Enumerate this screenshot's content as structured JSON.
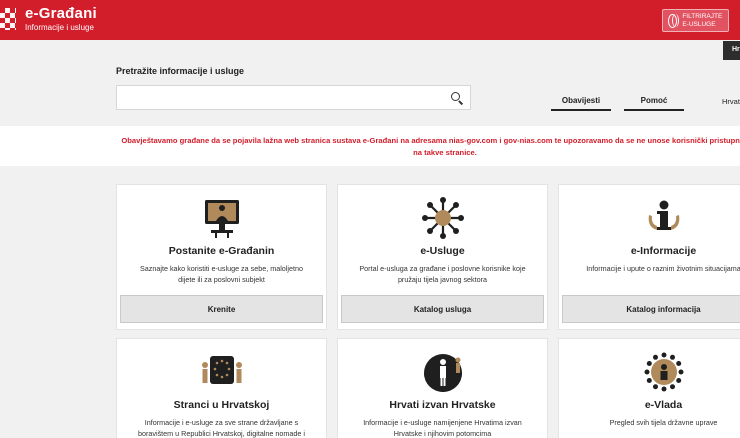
{
  "header": {
    "title": "e-Građani",
    "subtitle": "Informacije i usluge",
    "filter_button": "FILTRIRAJTE E-USLUGE",
    "right_button": "Hr"
  },
  "search": {
    "label": "Pretražite informacije i usluge",
    "placeholder": "",
    "value": ""
  },
  "tabs": [
    {
      "label": "Obavijesti"
    },
    {
      "label": "Pomoć"
    }
  ],
  "language": "Hrvat",
  "warning": "Obavještavamo građane da se pojavila lažna web stranica sustava e-Građani na adresama nias-gov.com i gov-nias.com te upozoravamo da se ne unose korisnički pristupni podaci na takve stranice.",
  "cards": [
    {
      "title": "Postanite e-Građanin",
      "desc": "Saznajte kako koristiti e-usluge za sebe, maloljetno dijete ili za poslovni subjekt",
      "cta": "Krenite",
      "icon": "computer-user-icon"
    },
    {
      "title": "e-Usluge",
      "desc": "Portal e-usluga za građane i poslovne korisnike koje pružaju tijela javnog sektora",
      "cta": "Katalog usluga",
      "icon": "services-network-icon"
    },
    {
      "title": "e-Informacije",
      "desc": "Informacije i upute o raznim životnim situacijama",
      "cta": "Katalog informacija",
      "icon": "information-person-icon"
    },
    {
      "title": "Stranci u Hrvatskoj",
      "desc": "Informacije i e-usluge za sve strane državljane s boravištem u Republici Hrvatskoj, digitalne nomade i",
      "icon": "eu-flag-people-icon"
    },
    {
      "title": "Hrvati izvan Hrvatske",
      "desc": "Informacije i e-usluge namijenjene Hrvatima izvan Hrvatske i njihovim potomcima",
      "icon": "globe-person-icon"
    },
    {
      "title": "e-Vlada",
      "desc": "Pregled svih tijela državne uprave",
      "icon": "government-circle-icon"
    }
  ],
  "colors": {
    "brand": "#d21d2b",
    "accent": "#b08a5a"
  }
}
